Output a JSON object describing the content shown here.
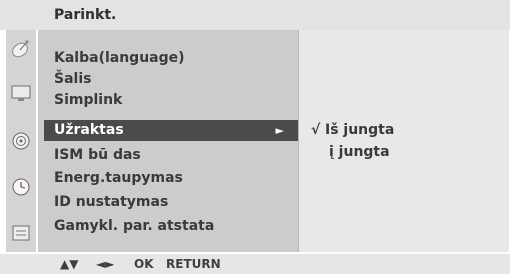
{
  "title": "Parinkt.",
  "sidebar_icons": [
    "satellite-dish-icon",
    "tv-screen-icon",
    "speaker-icon",
    "clock-icon",
    "settings-box-icon"
  ],
  "menu": {
    "items": [
      {
        "label": "Kalba(language)"
      },
      {
        "label": "Šalis"
      },
      {
        "label": "Simplink"
      },
      {
        "label": "Užraktas",
        "selected": true,
        "arrow": "►"
      },
      {
        "label": "ISM bū das"
      },
      {
        "label": "Energ.taupymas"
      },
      {
        "label": "ID nustatymas"
      },
      {
        "label": "Gamykl. par. atstata"
      }
    ]
  },
  "submenu": {
    "check_mark": "√",
    "options": [
      "Iš jungta",
      "į jungta"
    ]
  },
  "footer": {
    "nav_updown": "▲▼",
    "nav_leftright": "◄►",
    "ok": "OK",
    "return": "RETURN"
  }
}
